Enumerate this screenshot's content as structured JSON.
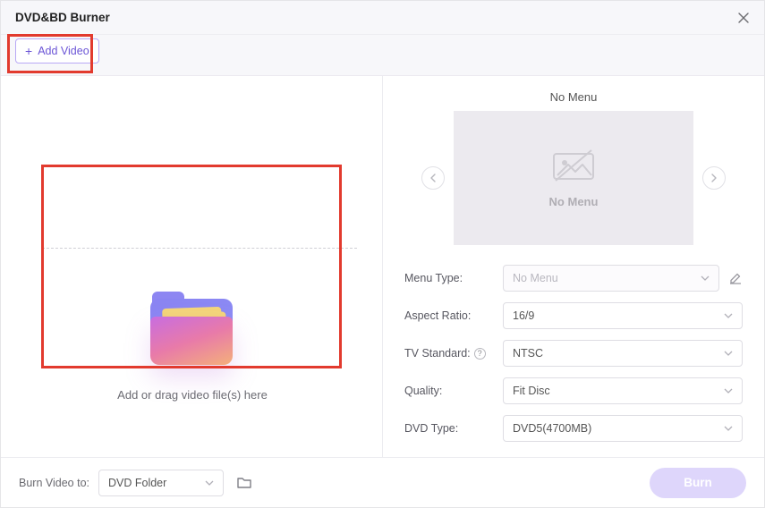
{
  "header": {
    "title": "DVD&BD Burner",
    "add_video_label": "Add Video"
  },
  "left": {
    "drop_text": "Add or drag video file(s) here"
  },
  "right": {
    "preview_title": "No Menu",
    "preview_label": "No Menu",
    "menu_type_label": "Menu Type:",
    "menu_type_value": "No Menu",
    "aspect_label": "Aspect Ratio:",
    "aspect_value": "16/9",
    "tv_label": "TV Standard:",
    "tv_value": "NTSC",
    "quality_label": "Quality:",
    "quality_value": "Fit Disc",
    "dvd_type_label": "DVD Type:",
    "dvd_type_value": "DVD5(4700MB)"
  },
  "footer": {
    "burn_to_label": "Burn Video to:",
    "burn_to_value": "DVD Folder",
    "burn_button": "Burn"
  }
}
